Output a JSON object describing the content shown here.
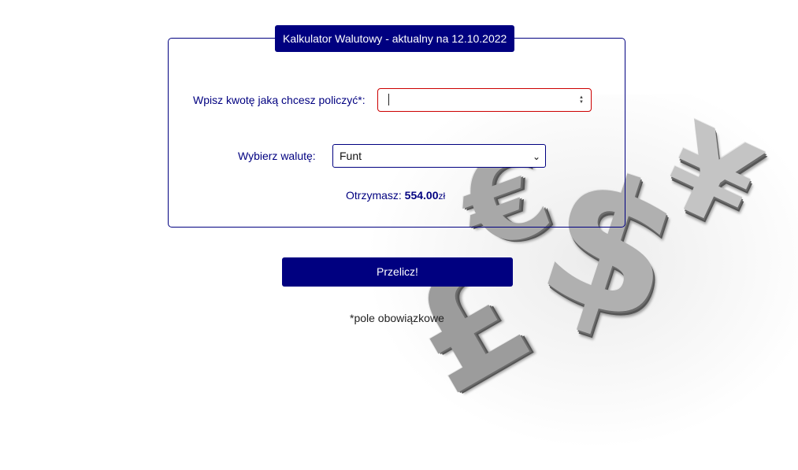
{
  "calculator": {
    "legend": "Kalkulator Walutowy - aktualny na 12.10.2022",
    "amount_label": "Wpisz kwotę jaką chcesz policzyć*:",
    "amount_value": "",
    "currency_label": "Wybierz walutę:",
    "currency_selected": "Funt",
    "result_label": "Otrzymasz:",
    "result_value": "554.00",
    "result_unit": "zł",
    "submit_label": "Przelicz!",
    "required_note": "*pole obowiązkowe"
  },
  "icons": {
    "spinner": "number-spinner-icon",
    "select_arrow": "chevron-down-icon",
    "text_cursor": "text-cursor-icon"
  },
  "colors": {
    "accent": "#000080",
    "error_border": "#cc0000",
    "background": "#ffffff"
  }
}
